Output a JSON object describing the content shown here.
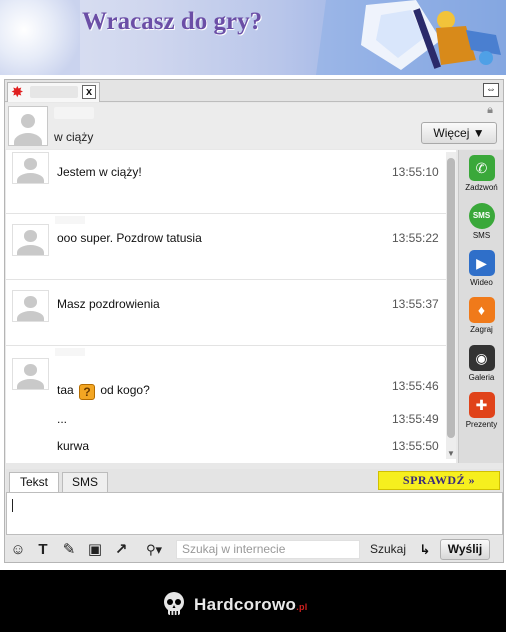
{
  "banner": {
    "title": "Wracasz do gry?"
  },
  "tab": {
    "close_label": "x",
    "undock_label": "⇔"
  },
  "contact": {
    "status": "w ciąży",
    "more_label": "Więcej ▼"
  },
  "messages": [
    {
      "lines": [
        {
          "text": "Jestem w ciąży!",
          "time": "13:55:10"
        }
      ]
    },
    {
      "lines": [
        {
          "text": "ooo super. Pozdrow tatusia",
          "time": "13:55:22"
        }
      ]
    },
    {
      "lines": [
        {
          "text": "Masz pozdrowienia",
          "time": "13:55:37"
        }
      ]
    },
    {
      "lines": [
        {
          "text_before": "taa",
          "emoticon": "?",
          "text_after": "od kogo?",
          "time": "13:55:46"
        },
        {
          "text": "...",
          "time": "13:55:49"
        },
        {
          "text": "kurwa",
          "time": "13:55:50"
        }
      ]
    }
  ],
  "sidebar": {
    "items": [
      {
        "label": "Zadzwoń",
        "icon": "phone-icon",
        "glyph": "✆",
        "color": "#3aa83a"
      },
      {
        "label": "SMS",
        "icon": "sms-icon",
        "glyph": "SMS",
        "color": "#3aa83a"
      },
      {
        "label": "Wideo",
        "icon": "video-icon",
        "glyph": "▶",
        "color": "#2f6fc9"
      },
      {
        "label": "Zagraj",
        "icon": "game-icon",
        "glyph": "♦",
        "color": "#f07a1a"
      },
      {
        "label": "Galeria",
        "icon": "camera-icon",
        "glyph": "◉",
        "color": "#333333"
      },
      {
        "label": "Prezenty",
        "icon": "gift-icon",
        "glyph": "✚",
        "color": "#e0431a"
      }
    ]
  },
  "input": {
    "tabs": [
      "Tekst",
      "SMS"
    ],
    "check_label": "SPRAWDŹ »"
  },
  "toolbar": {
    "icons": [
      {
        "name": "smiley-icon",
        "glyph": "☺"
      },
      {
        "name": "text-format-icon",
        "glyph": "T"
      },
      {
        "name": "tools-icon",
        "glyph": "✎"
      },
      {
        "name": "gift-icon",
        "glyph": "▣"
      },
      {
        "name": "share-icon",
        "glyph": "↗"
      },
      {
        "name": "search-icon",
        "glyph": "⚲▾"
      }
    ],
    "search_placeholder": "Szukaj w internecie",
    "search_label": "Szukaj",
    "enter_label": "↳",
    "send_label": "Wyślij"
  },
  "footer": {
    "brand": "Hardcorowo",
    "tld": ".pl"
  }
}
